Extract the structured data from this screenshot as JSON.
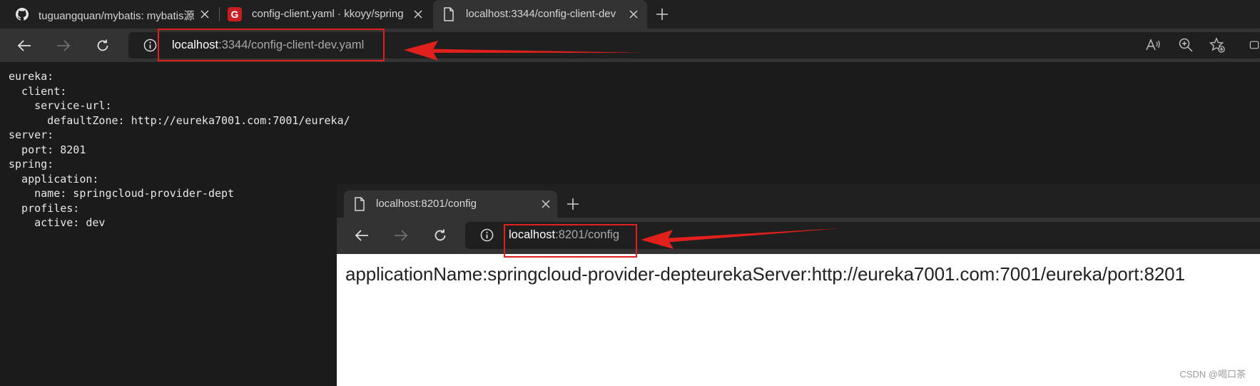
{
  "main_window": {
    "tabs": [
      {
        "title": "tuguangquan/mybatis: mybatis源",
        "icon": "github-icon"
      },
      {
        "title": "config-client.yaml · kkoyy/spring",
        "icon": "gitee-icon"
      },
      {
        "title": "localhost:3344/config-client-dev",
        "icon": "page-icon"
      }
    ],
    "address": {
      "host": "localhost",
      "path": ":3344/config-client-dev.yaml"
    },
    "yaml": "eureka:\n  client:\n    service-url:\n      defaultZone: http://eureka7001.com:7001/eureka/\nserver:\n  port: 8201\nspring:\n  application:\n    name: springcloud-provider-dept\n  profiles:\n    active: dev"
  },
  "overlay_window": {
    "tab_title": "localhost:8201/config",
    "address": {
      "host": "localhost",
      "path": ":8201/config"
    },
    "content": "applicationName:springcloud-provider-depteurekaServer:http://eureka7001.com:7001/eureka/port:8201"
  },
  "watermark": "CSDN @喝口茶",
  "colors": {
    "annotation": "#e0201c",
    "dark_bg": "#1b1b1b",
    "toolbar": "#333333"
  }
}
